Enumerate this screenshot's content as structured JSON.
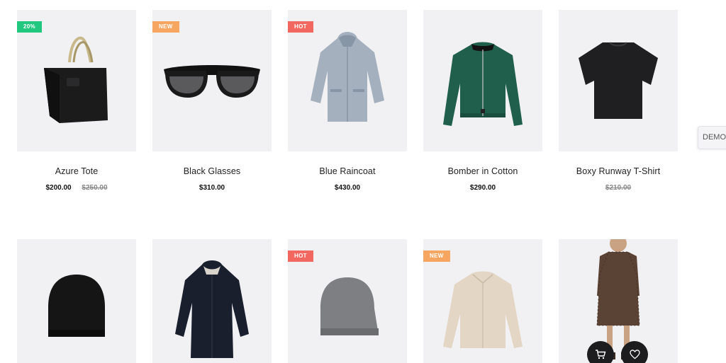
{
  "demo_tab": {
    "label": "DEMO"
  },
  "products": [
    {
      "name": "Azure Tote",
      "badge": "20%",
      "price": "$200.00",
      "old_price": "$250.00",
      "image": "tote-bag-icon"
    },
    {
      "name": "Black Glasses",
      "badge": "NEW",
      "price": "$310.00",
      "image": "sunglasses-icon"
    },
    {
      "name": "Blue Raincoat",
      "badge": "HOT",
      "price": "$430.00",
      "image": "raincoat-icon"
    },
    {
      "name": "Bomber in Cotton",
      "price": "$290.00",
      "image": "bomber-jacket-icon"
    },
    {
      "name": "Boxy Runway T-Shirt",
      "old_price": "$210.00",
      "image": "tshirt-icon"
    },
    {
      "image": "beanie-black-icon"
    },
    {
      "image": "parka-icon"
    },
    {
      "badge": "HOT",
      "image": "beanie-grey-icon"
    },
    {
      "badge": "NEW",
      "image": "beige-jacket-icon"
    },
    {
      "image": "dress-icon",
      "actions": [
        "add-to-cart-icon",
        "wishlist-heart-icon"
      ]
    }
  ],
  "colors": {
    "sale": "#22c77f",
    "new": "#f7a661",
    "hot": "#f2675f",
    "thumb_bg": "#f1f1f3",
    "action_bg": "#1d1d20"
  }
}
